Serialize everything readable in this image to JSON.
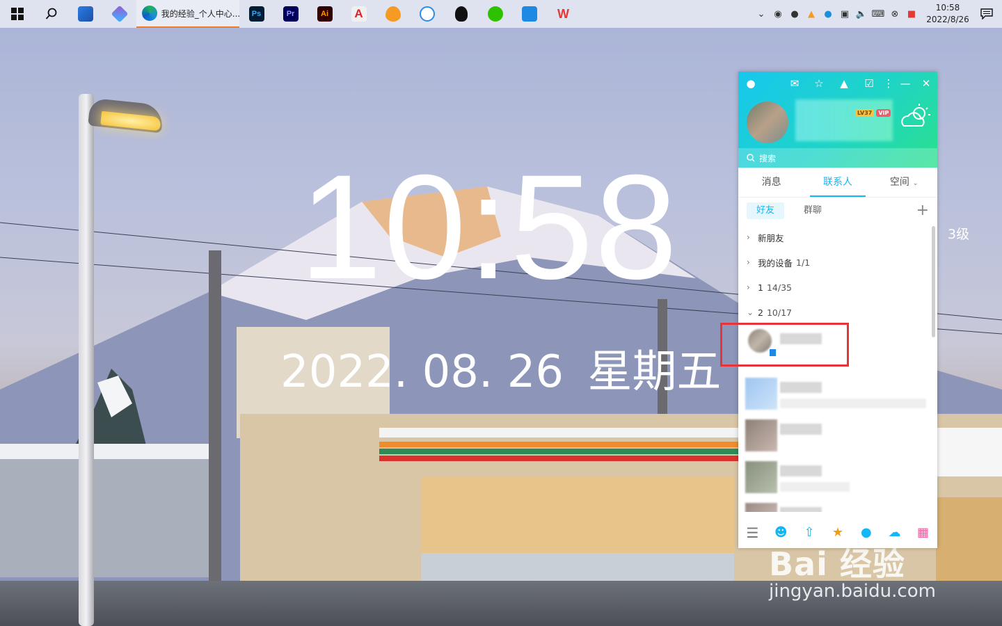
{
  "taskbar": {
    "edge_task_title": "我的经验_个人中心...",
    "apps": [
      "ps-icon",
      "pr-icon",
      "ai-icon",
      "acrobat-icon",
      "flame-icon",
      "baidu-netdisk-icon",
      "qq-icon",
      "wechat-icon",
      "feishu-icon",
      "wps-icon"
    ],
    "app_labels": {
      "ps": "Ps",
      "pr": "Pr",
      "ai": "Ai",
      "acrobat": "A",
      "wps": "W"
    },
    "tray": {
      "time": "10:58",
      "date": "2022/8/26"
    }
  },
  "desktop": {
    "clock": "10:58",
    "date": "2022. 08. 26",
    "weekday": "星期五",
    "level": "3级",
    "watermark_main": "Bai 经验",
    "watermark_sub": "jingyan.baidu.com"
  },
  "qq": {
    "vip_level": "LV37",
    "vip_label": "VIP",
    "search_placeholder": "搜索",
    "tabs": [
      {
        "label": "消息"
      },
      {
        "label": "联系人"
      },
      {
        "label": "空间"
      }
    ],
    "subtabs": {
      "friends": "好友",
      "groups": "群聊"
    },
    "groups": [
      {
        "label": "新朋友",
        "count": "",
        "expanded": false
      },
      {
        "label": "我的设备",
        "count": "1/1",
        "expanded": false
      },
      {
        "label": "1",
        "count": "14/35",
        "expanded": false
      },
      {
        "label": "2",
        "count": "10/17",
        "expanded": true
      }
    ]
  },
  "colors": {
    "accent": "#12b7f5",
    "highlight": "#e8333b",
    "header_start": "#17c7ee",
    "header_end": "#2be08d"
  }
}
